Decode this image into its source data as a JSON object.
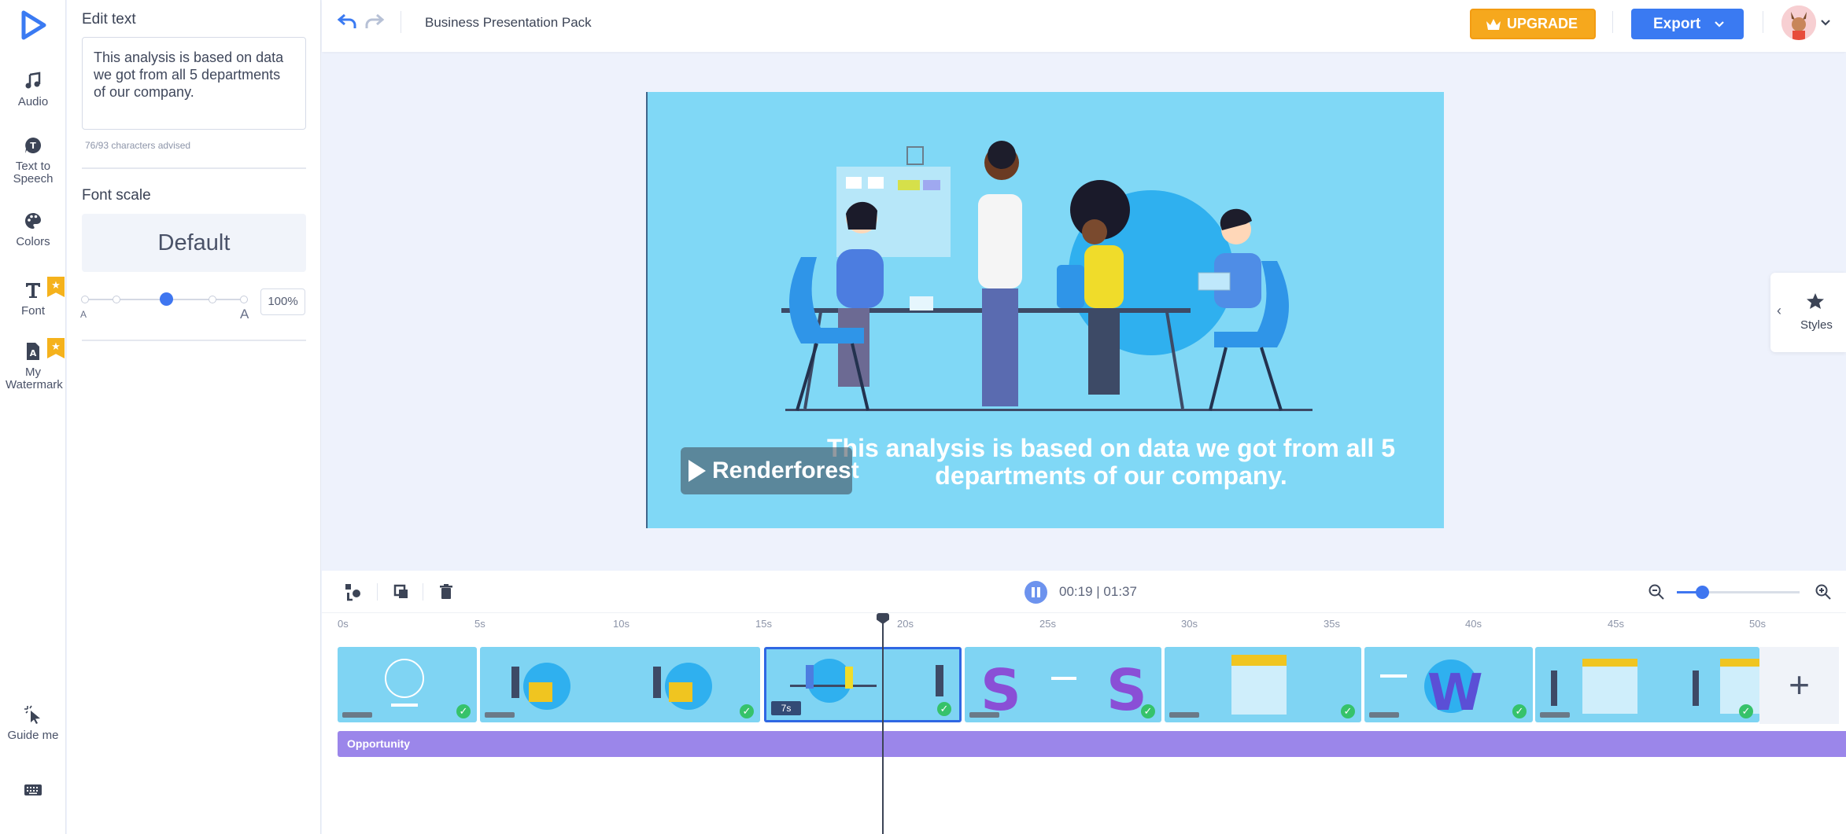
{
  "rail": {
    "items": [
      {
        "label": "Audio",
        "icon": "music-note-icon"
      },
      {
        "label": "Text to Speech",
        "icon": "text-to-speech-icon"
      },
      {
        "label": "Colors",
        "icon": "palette-icon"
      },
      {
        "label": "Font",
        "icon": "font-icon"
      },
      {
        "label": "My Watermark",
        "icon": "watermark-icon"
      },
      {
        "label": "Guide me",
        "icon": "cursor-sparkle-icon"
      }
    ],
    "keyboard_icon": "keyboard-icon"
  },
  "panel": {
    "edit_text_heading": "Edit text",
    "text_value": "This analysis is based on data we got from all 5 departments of our company.",
    "char_count": "76/93  characters advised",
    "font_scale_heading": "Font scale",
    "font_scale_value": "Default",
    "slider_min_label": "A",
    "slider_max_label": "A",
    "percent": "100%"
  },
  "topbar": {
    "project_title": "Business Presentation Pack",
    "upgrade_label": "UPGRADE",
    "export_label": "Export"
  },
  "canvas": {
    "caption": "This analysis is based on data we got from all 5 departments of our company.",
    "watermark": "Renderforest"
  },
  "styles_tab": {
    "label": "Styles"
  },
  "timeline": {
    "time": "00:19 | 01:37",
    "zoom_level": 0.2,
    "ticks": [
      "0s",
      "5s",
      "10s",
      "15s",
      "20s",
      "25s",
      "30s",
      "35s",
      "40s",
      "45s",
      "50s"
    ],
    "selected_scene_duration": "7s",
    "music_track": "Opportunity"
  },
  "colors": {
    "accent": "#3a7af2",
    "upgrade": "#f6a81d",
    "scene_bg": "#7fd4f3",
    "music": "#9b86ea"
  }
}
